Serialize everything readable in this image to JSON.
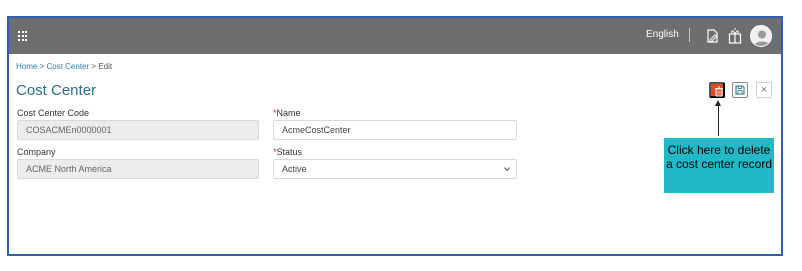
{
  "topbar": {
    "language": "English",
    "icons": [
      "apps-grid-icon",
      "edit-document-icon",
      "notification-gift-icon",
      "user-avatar-icon"
    ]
  },
  "breadcrumb": {
    "home": "Home",
    "sep": ">",
    "section": "Cost Center",
    "current": "Edit"
  },
  "page": {
    "title": "Cost Center"
  },
  "form": {
    "cost_center_code": {
      "label": "Cost Center Code",
      "value": "COSACMEn0000001"
    },
    "name": {
      "required_mark": "*",
      "label": "Name",
      "value": "AcmeCostCenter"
    },
    "company": {
      "label": "Company",
      "value": "ACME North America"
    },
    "status": {
      "required_mark": "*",
      "label": "Status",
      "value": "Active"
    }
  },
  "actions": {
    "close_glyph": "×",
    "delete_icon": "trash-icon",
    "save_icon": "save-icon"
  },
  "annotation": {
    "callout_text": "Click here to delete a cost center record"
  },
  "colors": {
    "topbar": "#6e6e6e",
    "title": "#2a6f86",
    "delete": "#e8481f",
    "callout": "#21b9c7",
    "frame": "#2d5fb5"
  }
}
